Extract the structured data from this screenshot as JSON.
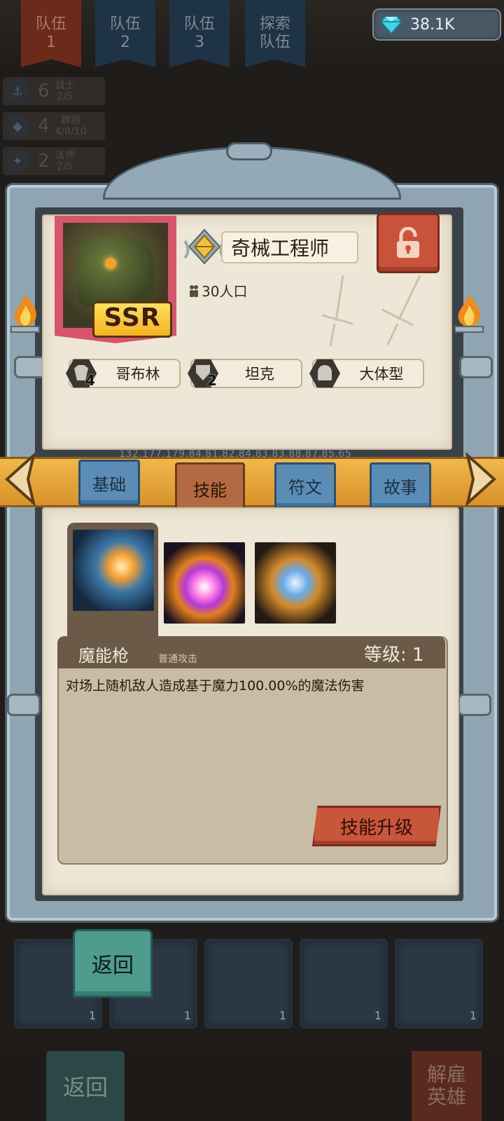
{
  "header": {
    "team_tabs": [
      {
        "line1": "队伍",
        "line2": "1"
      },
      {
        "line1": "队伍",
        "line2": "2"
      },
      {
        "line1": "队伍",
        "line2": "3"
      },
      {
        "line1": "探索",
        "line2": "队伍"
      }
    ],
    "gems": "38.1K"
  },
  "class_summary": [
    {
      "count": "6",
      "name": "战士",
      "ratio": "2/5"
    },
    {
      "count": "4",
      "name": "群狼",
      "ratio": "4/8/10"
    },
    {
      "count": "2",
      "name": "法师",
      "ratio": "2/5"
    }
  ],
  "hero": {
    "rarity": "SSR",
    "name": "奇械工程师",
    "population": "30人口",
    "traits": [
      {
        "count": "4",
        "label": "哥布林"
      },
      {
        "count": "2",
        "label": "坦克"
      },
      {
        "count": "",
        "label": "大体型"
      }
    ]
  },
  "debug_overlay": "132,177,179,84,81,82,84,83,83,88,87,85,65",
  "tabs": [
    "基础",
    "技能",
    "符文",
    "故事"
  ],
  "skill": {
    "name": "魔能枪",
    "type": "普通攻击",
    "level": "等级: 1",
    "description": "对场上随机敌人造成基于魔力100.00%的魔法伤害",
    "upgrade_label": "技能升级"
  },
  "back_label": "返回",
  "bottom_bar": {
    "back_label": "返回",
    "dismiss_line1": "解雇",
    "dismiss_line2": "英雄"
  },
  "hero_grid_levels": [
    "1",
    "1",
    "1",
    "1",
    "1"
  ]
}
